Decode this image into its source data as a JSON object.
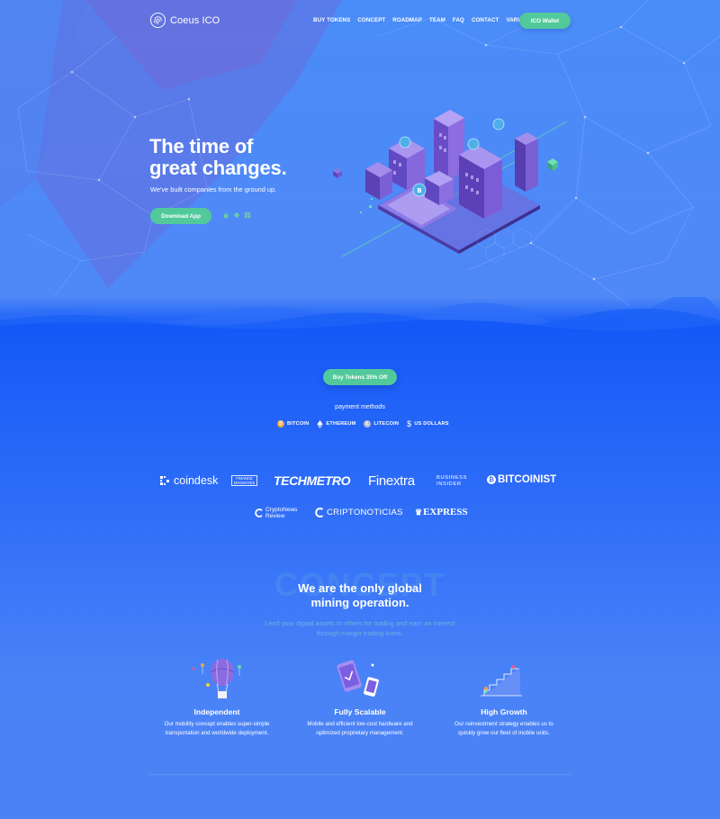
{
  "header": {
    "logo_text": "Coeus ICO",
    "nav": [
      "BUY TOKENS",
      "CONCEPT",
      "ROADMAP",
      "TEAM",
      "FAQ",
      "CONTACT",
      "VARIANTS"
    ],
    "wallet_button": "ICO Wallet"
  },
  "hero": {
    "title_line1": "The time of",
    "title_line2": "great changes.",
    "subtitle": "We've built companies from the ground up.",
    "download_button": "Download App",
    "platform_icons": [
      "apple-icon",
      "android-icon",
      "windows-icon"
    ]
  },
  "tokens": {
    "buy_button": "Buy Tokens 35% Off",
    "payment_title": "payment methods",
    "payment_methods": [
      {
        "label": "BITCOIN",
        "icon": "bitcoin-icon",
        "color": "#f2a33a"
      },
      {
        "label": "ETHEREUM",
        "icon": "ethereum-icon",
        "color": "#ffffff"
      },
      {
        "label": "LITECOIN",
        "icon": "litecoin-icon",
        "color": "#b9bfd0"
      },
      {
        "label": "US DOLLARS",
        "icon": "dollar-icon",
        "color": "#ffffff"
      }
    ]
  },
  "press": {
    "coindesk": "coindesk",
    "magnates_line1": "FINANCE",
    "magnates_line2": "MAGNATES",
    "techmetro": "TECHMETRO",
    "finextra": "Finextra",
    "business_insider_line1": "BUSINESS",
    "business_insider_line2": "INSIDER",
    "bitcoinist": "BITCOINIST",
    "cryptonews_line1": "CryptoNews",
    "cryptonews_line2": "Review",
    "criptonoticias": "CRIPTONOTICIAS",
    "express": "EXPRESS"
  },
  "concept": {
    "background_word": "CONCEPT",
    "title_line1": "We are the only global",
    "title_line2": "mining operation.",
    "subtitle_line1": "Lend your digital assets to others for trading and earn an interest",
    "subtitle_line2": "through margin trading loans.",
    "features": [
      {
        "title": "Independent",
        "line1": "Our mobility concept enables super-simple",
        "line2": "transportation and worldwide deployment.",
        "icon": "balloon-icon"
      },
      {
        "title": "Fully Scalable",
        "line1": "Mobile and efficient low-cost hardware and",
        "line2": "optimized proprietary management.",
        "icon": "mobile-devices-icon"
      },
      {
        "title": "High Growth",
        "line1": "Our reinvestment strategy enables us to",
        "line2": "quickly grow our fleet of mobile units.",
        "icon": "growth-chart-icon"
      }
    ]
  },
  "colors": {
    "accent": "#52c99a",
    "hero_bg": "#4f88f7",
    "band_bg": "#1459f7"
  }
}
